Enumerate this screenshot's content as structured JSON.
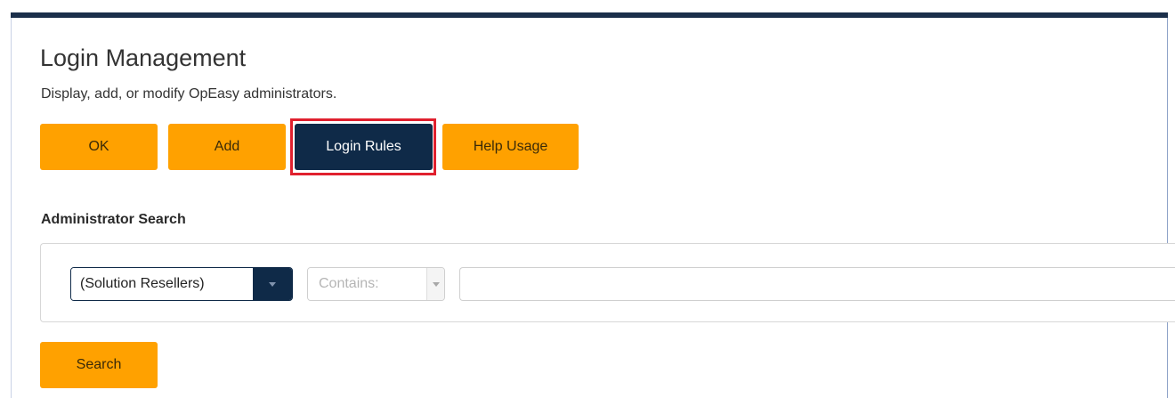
{
  "page": {
    "title": "Login Management",
    "subtitle": "Display, add, or modify OpEasy administrators."
  },
  "toolbar": {
    "ok_label": "OK",
    "add_label": "Add",
    "login_rules_label": "Login Rules",
    "help_usage_label": "Help Usage"
  },
  "search": {
    "section_title": "Administrator Search",
    "scope_selected": "(Solution Resellers)",
    "operator_selected": "Contains:",
    "query_value": "",
    "search_label": "Search"
  },
  "colors": {
    "accent": "#ffa100",
    "primary_dark": "#0f2a48",
    "highlight": "#e0202e"
  },
  "icons": {
    "scope_dropdown": "chevron-down-icon",
    "operator_dropdown": "chevron-down-icon"
  }
}
